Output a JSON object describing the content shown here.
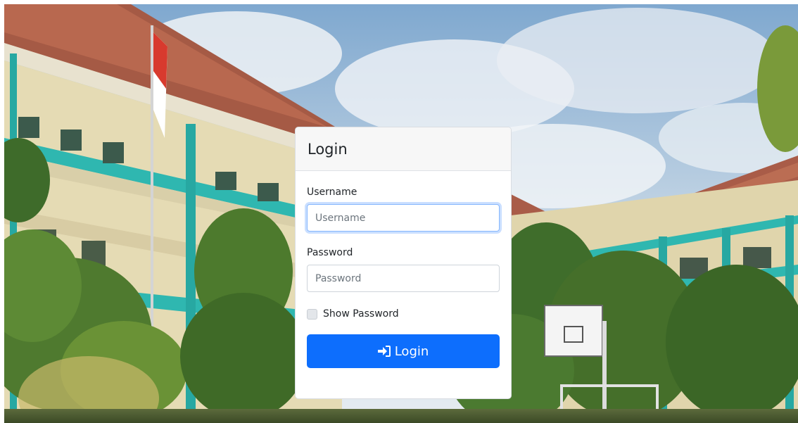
{
  "login_card": {
    "title": "Login",
    "username": {
      "label": "Username",
      "placeholder": "Username",
      "value": ""
    },
    "password": {
      "label": "Password",
      "placeholder": "Password",
      "value": ""
    },
    "show_password": {
      "label": "Show Password",
      "checked": false
    },
    "submit": {
      "label": "Login",
      "icon": "sign-in-icon"
    }
  },
  "colors": {
    "primary": "#0d6efd",
    "focus_ring": "#86b7fe",
    "card_header_bg": "#f7f7f7"
  }
}
